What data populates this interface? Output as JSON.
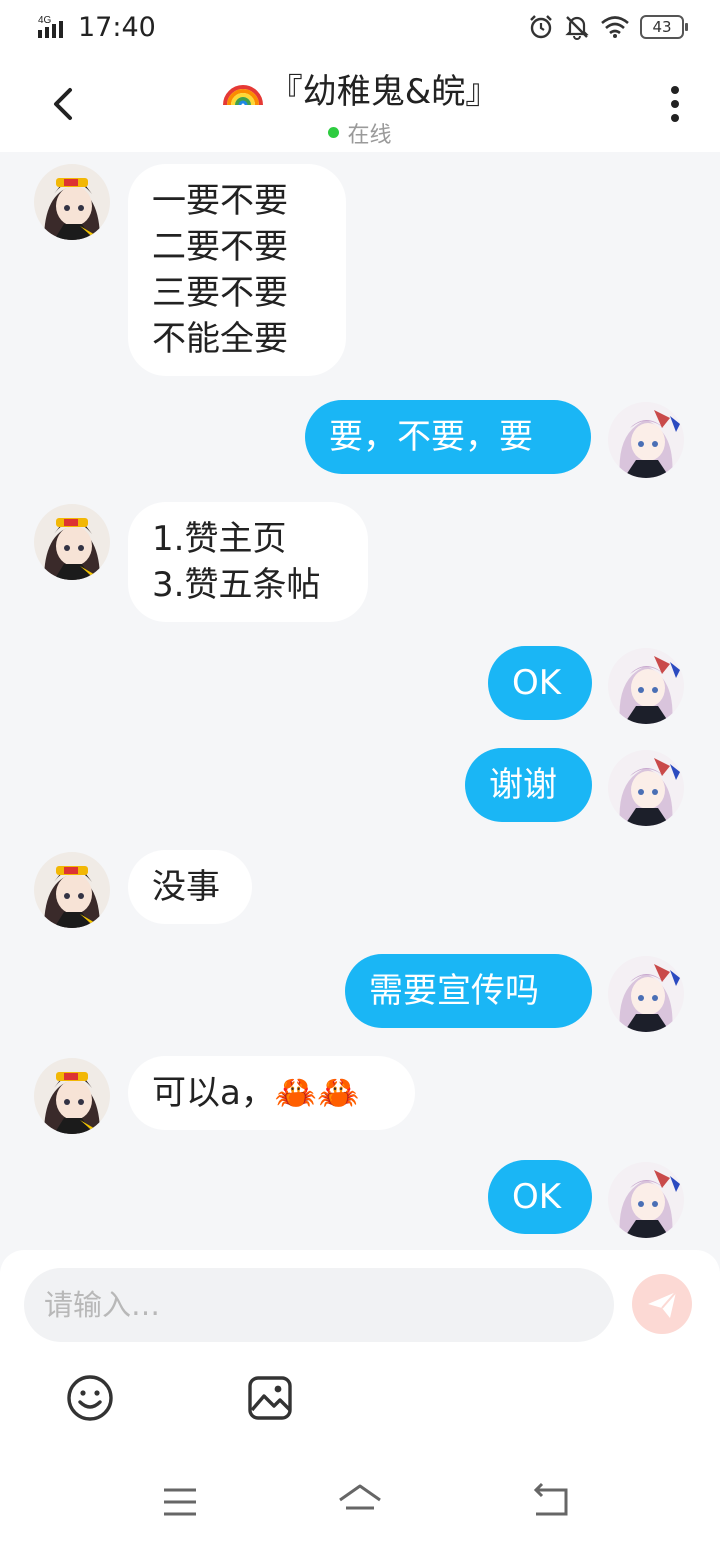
{
  "status_bar": {
    "network": "4G",
    "time": "17:40",
    "battery": "43",
    "icons": [
      "alarm-icon",
      "mute-bell-icon",
      "wifi-icon",
      "battery-icon"
    ]
  },
  "header": {
    "title": "『幼稚鬼&皖』",
    "title_emoji": "rainbow-icon",
    "status": "在线",
    "status_color": "#2ecc40"
  },
  "messages": [
    {
      "side": "left",
      "text": "一要不要\n二要不要\n三要不要\n不能全要"
    },
    {
      "side": "right",
      "text": "要，不要，要"
    },
    {
      "side": "left",
      "text": "1.赞主页\n3.赞五条帖"
    },
    {
      "side": "right",
      "text": "OK"
    },
    {
      "side": "right",
      "text": "谢谢"
    },
    {
      "side": "left",
      "text": "没事"
    },
    {
      "side": "right",
      "text": "需要宣传吗"
    },
    {
      "side": "left",
      "text": "可以a，🦀🦀"
    },
    {
      "side": "right",
      "text": "OK"
    }
  ],
  "composer": {
    "placeholder": "请输入…",
    "send_icon": "send-icon",
    "tools": [
      "emoji-icon",
      "image-icon"
    ]
  },
  "nav": {
    "buttons": [
      "menu-icon",
      "home-icon",
      "back-nav-icon"
    ]
  },
  "colors": {
    "accent": "#1ab6f5",
    "background": "#f5f6f8",
    "send_button": "#fcd9d4"
  }
}
